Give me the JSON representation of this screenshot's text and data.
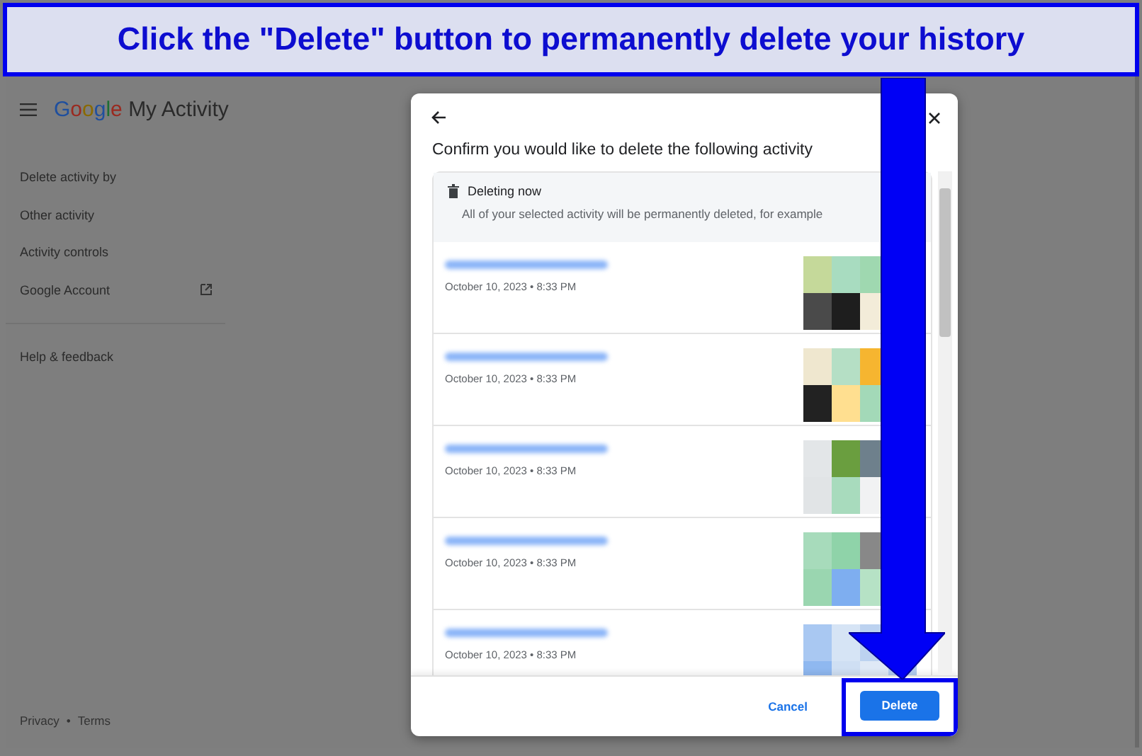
{
  "annotation": {
    "text": "Click the \"Delete\" button to permanently delete your history"
  },
  "app": {
    "logo": "Google",
    "title": "My Activity"
  },
  "sidebar": {
    "items": [
      {
        "label": "Delete activity by",
        "kind": "plain"
      },
      {
        "label": "Other activity",
        "kind": "plain"
      },
      {
        "label": "Activity controls",
        "kind": "plain"
      },
      {
        "label": "Google Account",
        "kind": "external"
      },
      {
        "label": "Help & feedback",
        "kind": "separated"
      }
    ],
    "footer": {
      "links": [
        "Privacy",
        "Terms"
      ],
      "separator": "•"
    }
  },
  "dialog": {
    "title": "Confirm you would like to delete the following activity",
    "notice": {
      "title": "Deleting now",
      "text": "All of your selected activity will be permanently deleted, for example"
    },
    "items": [
      {
        "date": "October 10, 2023 • 8:33 PM"
      },
      {
        "date": "October 10, 2023 • 8:33 PM"
      },
      {
        "date": "October 10, 2023 • 8:33 PM"
      },
      {
        "date": "October 10, 2023 • 8:33 PM"
      },
      {
        "date": "October 10, 2023 • 8:33 PM"
      }
    ],
    "buttons": [
      {
        "label": "Cancel",
        "kind": "text",
        "highlighted": false
      },
      {
        "label": "Delete",
        "kind": "filled",
        "highlighted": true
      }
    ]
  }
}
